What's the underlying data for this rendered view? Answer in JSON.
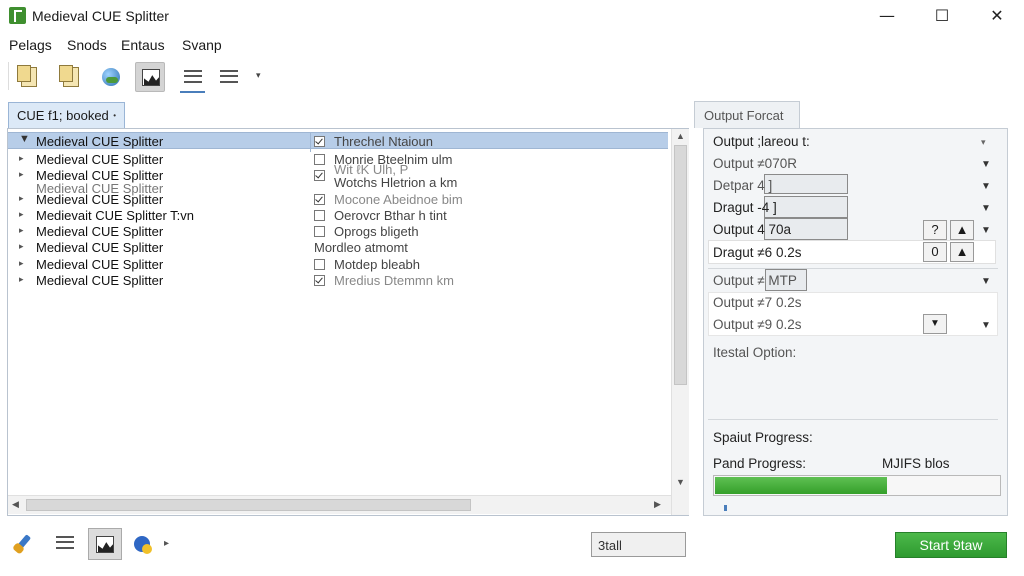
{
  "window": {
    "title": "Medieval CUE Splitter",
    "minimize_glyph": "—",
    "maximize_glyph": "☐",
    "close_glyph": "✕"
  },
  "menu": [
    "Pelags",
    "Snods",
    "Entaus",
    "Svanp"
  ],
  "toolbar": {
    "icons": [
      "paste-icon",
      "copy-icon",
      "globe-icon",
      "waveform-icon",
      "list-icon",
      "list-detail-icon"
    ],
    "dropdown_glyph": "▾"
  },
  "file_tab": {
    "label": "CUE f1; booked",
    "dot": "•"
  },
  "tree": {
    "rows": [
      {
        "label": "Medieval CUE Splitter",
        "col": "Threchel Ntaioun",
        "checked": true,
        "selected": true
      },
      {
        "label": "Medieval CUE Splitter",
        "col": "Monrie Bteelnim ulm",
        "checked": false
      },
      {
        "label": "Medieval CUE Splitter",
        "col": "Wotchs Hletrion a km",
        "checked": true
      },
      {
        "label": "Medieval CUE Splitter",
        "col": "Mocone Abeidnoe bim",
        "checked": true
      },
      {
        "label": "Medieval CUE Splitter",
        "col": "Oerovcr Bthar h tint",
        "checked": false
      },
      {
        "label": "Medieval CUE Splitter",
        "col": "Oprogs bligeth",
        "checked": false
      },
      {
        "label": "Medieval CUE Splitter",
        "col": "Mordleo atmomt",
        "checked": false
      },
      {
        "label": "Medieval CUE Splitter",
        "col": "Motdep bleabh",
        "checked": false
      },
      {
        "label": "Medieval CUE Splitter",
        "col": "Mredius Dtemmn km",
        "checked": true
      }
    ],
    "ghost_label": "Medieval CUE Splitter",
    "ghost_col": "Wit ℓK Ulh, P",
    "suffix_row_label": "Medievait CUE Splitter T:vn"
  },
  "output_panel": {
    "tab": "Output Forcat",
    "rows": [
      {
        "label": "Output ;lareou t:"
      },
      {
        "label": "Output ≠070R"
      },
      {
        "label": "Detpar 4 ]"
      },
      {
        "label": "Dragut -4 ]"
      },
      {
        "label": "Output 4 70a"
      },
      {
        "label": "Dragut ≠6 0.2s"
      },
      {
        "label": "Output ≠ MTP"
      },
      {
        "label": "Output ≠7 0.2s"
      },
      {
        "label": "Output ≠9 0.2s"
      }
    ],
    "spin_values": [
      "?",
      "▲",
      "0",
      "▲"
    ],
    "small_caret": "▾",
    "row_caret": "▼",
    "option_label": "Itestal Option:",
    "split_progress": "Spaiut Progress:",
    "pand_progress": "Pand Progress:",
    "progress_text": "MJIFS blos",
    "progress": 0.6
  },
  "bottom": {
    "status": "3tall",
    "start_button": "Start 9taw",
    "icons": [
      "brush-icon",
      "list-icon",
      "waveform-icon",
      "tag-icon"
    ],
    "dropdown_glyph": "▸"
  }
}
